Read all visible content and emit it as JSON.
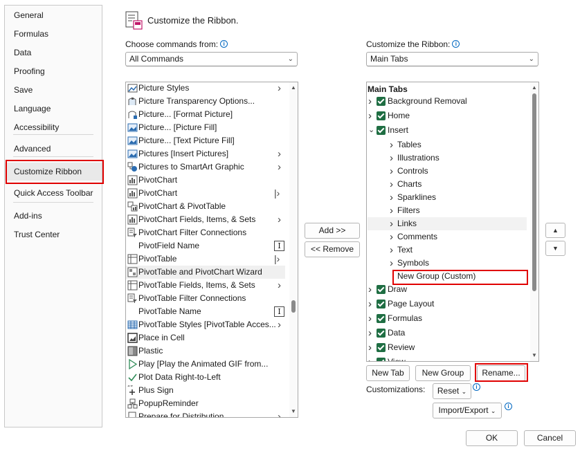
{
  "nav": {
    "items": [
      {
        "label": "General"
      },
      {
        "label": "Formulas"
      },
      {
        "label": "Data"
      },
      {
        "label": "Proofing"
      },
      {
        "label": "Save"
      },
      {
        "label": "Language"
      },
      {
        "label": "Accessibility"
      },
      {
        "label": "Advanced"
      },
      {
        "label": "Customize Ribbon"
      },
      {
        "label": "Quick Access Toolbar"
      },
      {
        "label": "Add-ins"
      },
      {
        "label": "Trust Center"
      }
    ],
    "active_index": 8
  },
  "header": {
    "title": "Customize the Ribbon."
  },
  "left": {
    "label": "Choose commands from:",
    "combo_value": "All Commands",
    "commands": [
      {
        "label": "Picture Styles",
        "icon": "picture-styles-icon",
        "submenu": true
      },
      {
        "label": "Picture Transparency Options...",
        "icon": "transparency-icon"
      },
      {
        "label": "Picture... [Format Picture]",
        "icon": "format-picture-icon"
      },
      {
        "label": "Picture... [Picture Fill]",
        "icon": "picture-fill-icon"
      },
      {
        "label": "Picture... [Text Picture Fill]",
        "icon": "picture-fill-icon"
      },
      {
        "label": "Pictures [Insert Pictures]",
        "icon": "picture-fill-icon",
        "submenu": true
      },
      {
        "label": "Pictures to SmartArt Graphic",
        "icon": "smartart-icon",
        "submenu": true
      },
      {
        "label": "PivotChart",
        "icon": "pivotchart-icon"
      },
      {
        "label": "PivotChart",
        "icon": "pivotchart-icon",
        "splitter": true
      },
      {
        "label": "PivotChart & PivotTable",
        "icon": "pivotchart-table-icon"
      },
      {
        "label": "PivotChart Fields, Items, & Sets",
        "icon": "pivotchart-icon",
        "submenu": true
      },
      {
        "label": "PivotChart Filter Connections",
        "icon": "filter-connections-icon"
      },
      {
        "label": "PivotField Name",
        "icon": "",
        "textbox": true
      },
      {
        "label": "PivotTable",
        "icon": "pivottable-icon",
        "splitter": true
      },
      {
        "label": "PivotTable and PivotChart Wizard",
        "icon": "wizard-icon",
        "selected": true
      },
      {
        "label": "PivotTable Fields, Items, & Sets",
        "icon": "pivottable-icon",
        "submenu": true
      },
      {
        "label": "PivotTable Filter Connections",
        "icon": "filter-connections-icon"
      },
      {
        "label": "PivotTable Name",
        "icon": "",
        "textbox": true
      },
      {
        "label": "PivotTable Styles [PivotTable Acces...",
        "icon": "table-styles-icon",
        "submenu": true
      },
      {
        "label": "Place in Cell",
        "icon": "place-in-cell-icon"
      },
      {
        "label": "Plastic",
        "icon": "plastic-icon"
      },
      {
        "label": "Play [Play the Animated GIF from...",
        "icon": "play-icon"
      },
      {
        "label": "Plot Data Right-to-Left",
        "icon": "checkmark-icon"
      },
      {
        "label": "Plus Sign",
        "icon": "plus-sign-icon"
      },
      {
        "label": "PopupReminder",
        "icon": "popup-icon"
      },
      {
        "label": "Prepare for Distribution",
        "icon": "prepare-icon",
        "submenu": true
      }
    ]
  },
  "middle": {
    "add_label": "Add >>",
    "remove_label": "<< Remove"
  },
  "right": {
    "label": "Customize the Ribbon:",
    "combo_value": "Main Tabs",
    "tree_header": "Main Tabs",
    "tree": [
      {
        "label": "Background Removal",
        "level": 0,
        "checked": true,
        "expanded": false
      },
      {
        "label": "Home",
        "level": 0,
        "checked": true,
        "expanded": false
      },
      {
        "label": "Insert",
        "level": 0,
        "checked": true,
        "expanded": true
      },
      {
        "label": "Tables",
        "level": 1
      },
      {
        "label": "Illustrations",
        "level": 1
      },
      {
        "label": "Controls",
        "level": 1
      },
      {
        "label": "Charts",
        "level": 1
      },
      {
        "label": "Sparklines",
        "level": 1
      },
      {
        "label": "Filters",
        "level": 1
      },
      {
        "label": "Links",
        "level": 1,
        "hover": true
      },
      {
        "label": "Comments",
        "level": 1
      },
      {
        "label": "Text",
        "level": 1
      },
      {
        "label": "Symbols",
        "level": 1
      },
      {
        "label": "New Group (Custom)",
        "level": 1,
        "nochevron": true,
        "highlight": true
      },
      {
        "label": "Draw",
        "level": 0,
        "checked": true,
        "expanded": false
      },
      {
        "label": "Page Layout",
        "level": 0,
        "checked": true,
        "expanded": false
      },
      {
        "label": "Formulas",
        "level": 0,
        "checked": true,
        "expanded": false
      },
      {
        "label": "Data",
        "level": 0,
        "checked": true,
        "expanded": false
      },
      {
        "label": "Review",
        "level": 0,
        "checked": true,
        "expanded": false
      },
      {
        "label": "View",
        "level": 0,
        "checked": true,
        "expanded": false
      }
    ],
    "new_tab_label": "New Tab",
    "new_group_label": "New Group",
    "rename_label": "Rename...",
    "customizations_label": "Customizations:",
    "reset_label": "Reset",
    "import_export_label": "Import/Export"
  },
  "footer": {
    "ok_label": "OK",
    "cancel_label": "Cancel"
  },
  "colors": {
    "highlight": "#e00000",
    "checkbox": "#1f6e43",
    "accent": "#0067c0"
  }
}
